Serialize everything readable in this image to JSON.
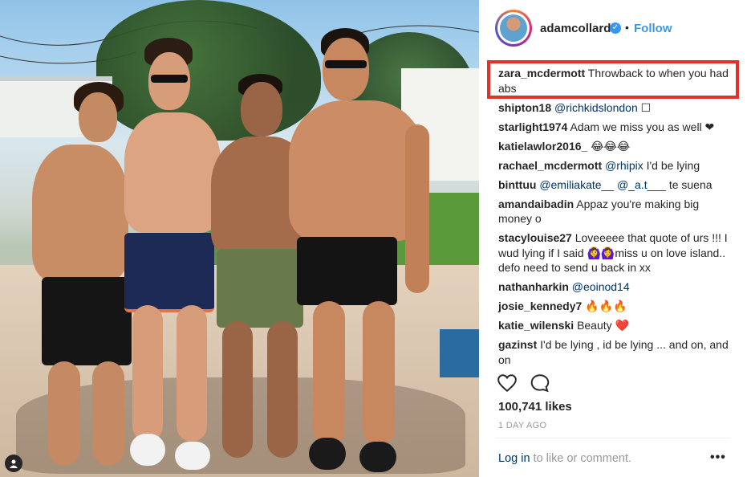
{
  "post": {
    "username": "adamcollard",
    "verified_icon": "verified-badge-icon",
    "separator": "•",
    "follow_label": "Follow"
  },
  "comments": [
    {
      "user": "zara_mcdermott",
      "text": "Throwback to when you had abs"
    },
    {
      "user": "shipton18",
      "mention": "@richkidslondon",
      "text": " ☐"
    },
    {
      "user": "starlight1974",
      "text": "Adam we miss you as well ❤"
    },
    {
      "user": "katielawlor2016_",
      "text": "😂😂😂"
    },
    {
      "user": "rachael_mcdermott",
      "mention": "@rhipix",
      "text": " I'd be lying"
    },
    {
      "user": "binttuu",
      "mention": "@emiliakate__ @_a.t___",
      "text": " te suena"
    },
    {
      "user": "amandaibadin",
      "text": "Appaz you're making big money o"
    },
    {
      "user": "stacylouise27",
      "text": "Loveeeee that quote of urs !!! I wud lying if I said 🙆‍♀️🙆‍♀️miss u on love island.. defo need to send u back in xx"
    },
    {
      "user": "nathanharkin",
      "mention": "@eoinod14",
      "text": ""
    },
    {
      "user": "josie_kennedy7",
      "text": "🔥🔥🔥"
    },
    {
      "user": "katie_wilenski",
      "text": "Beauty ❤️"
    },
    {
      "user": "gazinst",
      "text": "I'd be lying , id be lying ... and on, and on"
    }
  ],
  "actions": {
    "like_icon": "heart-icon",
    "comment_icon": "comment-bubble-icon"
  },
  "likes": "100,741 likes",
  "date": "1 DAY AGO",
  "footer": {
    "login_link": "Log in",
    "login_text": " to like or comment.",
    "more_label": "•••"
  },
  "colors": {
    "link": "#003569",
    "follow": "#3897f0",
    "highlight_border": "#e0312c",
    "muted": "#999999"
  }
}
